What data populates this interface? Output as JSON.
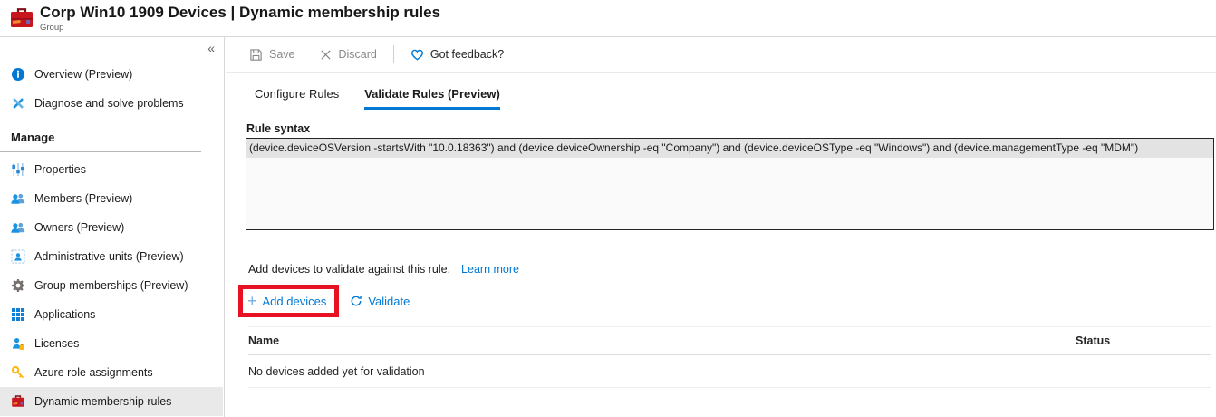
{
  "header": {
    "title": "Corp Win10 1909 Devices | Dynamic membership rules",
    "subtitle": "Group"
  },
  "sidebar": {
    "collapse_glyph": "«",
    "section_label": "Manage",
    "top_items": [
      {
        "label": "Overview (Preview)",
        "icon": "info-icon"
      },
      {
        "label": "Diagnose and solve problems",
        "icon": "tools-icon"
      }
    ],
    "manage_items": [
      {
        "label": "Properties",
        "icon": "sliders-icon"
      },
      {
        "label": "Members (Preview)",
        "icon": "people-icon"
      },
      {
        "label": "Owners (Preview)",
        "icon": "people-icon"
      },
      {
        "label": "Administrative units (Preview)",
        "icon": "admin-units-icon"
      },
      {
        "label": "Group memberships (Preview)",
        "icon": "gear-icon"
      },
      {
        "label": "Applications",
        "icon": "grid-icon"
      },
      {
        "label": "Licenses",
        "icon": "license-icon"
      },
      {
        "label": "Azure role assignments",
        "icon": "key-icon"
      },
      {
        "label": "Dynamic membership rules",
        "icon": "briefcase-icon",
        "selected": true
      }
    ]
  },
  "toolbar": {
    "save_label": "Save",
    "discard_label": "Discard",
    "feedback_label": "Got feedback?"
  },
  "tabs": [
    {
      "label": "Configure Rules",
      "active": false
    },
    {
      "label": "Validate Rules (Preview)",
      "active": true
    }
  ],
  "rule_syntax": {
    "label": "Rule syntax",
    "value": "(device.deviceOSVersion -startsWith \"10.0.18363\") and (device.deviceOwnership -eq \"Company\") and (device.deviceOSType -eq \"Windows\") and (device.managementType -eq \"MDM\")"
  },
  "validation": {
    "instruction": "Add devices to validate against this rule.",
    "learn_more_label": "Learn more",
    "add_devices_label": "Add devices",
    "plus_glyph": "+",
    "validate_label": "Validate"
  },
  "table": {
    "columns": {
      "name": "Name",
      "status": "Status"
    },
    "empty_message": "No devices added yet for validation"
  },
  "colors": {
    "accent_blue": "#0078d4",
    "annotation_red": "#e81123",
    "group_icon_red": "#c8161d",
    "key_yellow": "#fdb913",
    "selected_item_bg": "#e9e9e9",
    "rule_line_bg": "#e3e3e3"
  }
}
